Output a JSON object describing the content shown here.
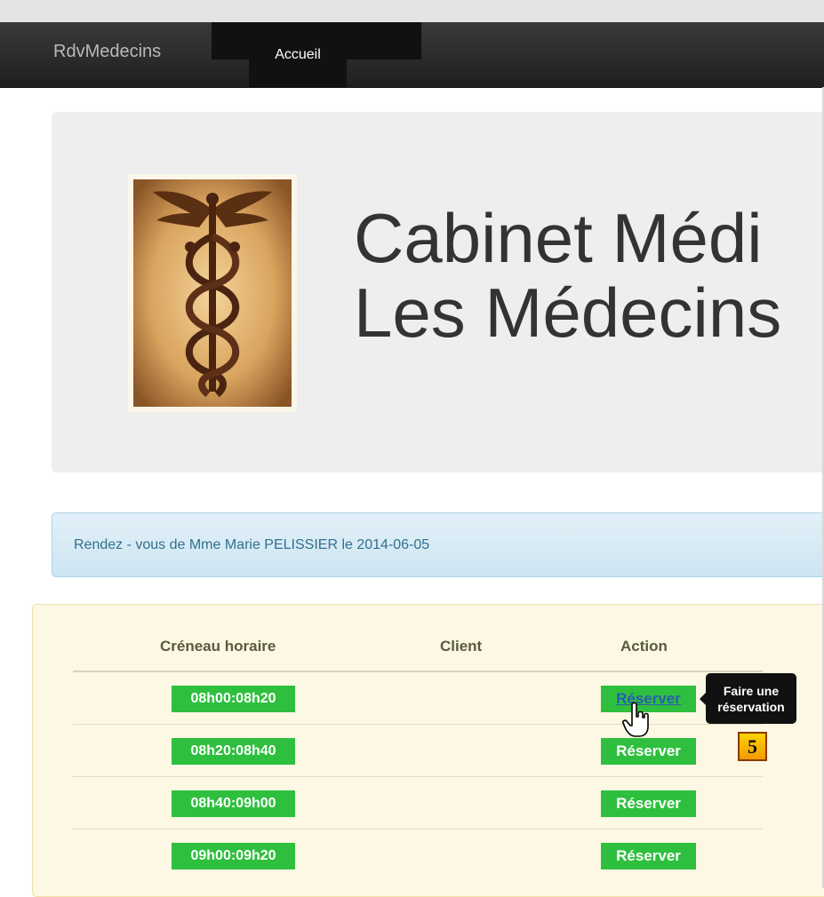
{
  "navbar": {
    "brand": "RdvMedecins",
    "active_item": "Accueil"
  },
  "jumbotron": {
    "headline_line1": "Cabinet Médi",
    "headline_line2": "Les Médecins"
  },
  "alert": {
    "text": "Rendez - vous de Mme Marie PELISSIER le 2014-06-05"
  },
  "table": {
    "headers": [
      "Créneau horaire",
      "Client",
      "Action"
    ],
    "rows": [
      {
        "slot": "08h00:08h20",
        "client": "",
        "action": "Réserver"
      },
      {
        "slot": "08h20:08h40",
        "client": "",
        "action": "Réserver"
      },
      {
        "slot": "08h40:09h00",
        "client": "",
        "action": "Réserver"
      },
      {
        "slot": "09h00:09h20",
        "client": "",
        "action": "Réserver"
      }
    ]
  },
  "tooltip": {
    "line1": "Faire une",
    "line2": "réservation"
  },
  "step_badge": "5",
  "colors": {
    "slot_green": "#2fbf3f",
    "navbar": "#222222",
    "alert_bg": "#d9edf7",
    "panel_bg": "#fcf8e3"
  },
  "icons": {
    "logo": "caduceus-logo-icon",
    "cursor": "hand-pointer-icon"
  }
}
